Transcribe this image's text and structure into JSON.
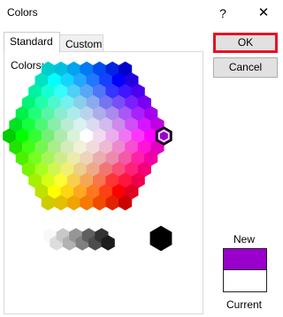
{
  "window": {
    "title": "Colors",
    "help_label": "?",
    "close_label": "✕"
  },
  "tabs": [
    {
      "label": "Standard"
    },
    {
      "label": "Custom"
    }
  ],
  "colors_label": "Colors:",
  "buttons": {
    "ok": "OK",
    "cancel": "Cancel"
  },
  "preview": {
    "new_label": "New",
    "current_label": "Current",
    "new_color": "#9900cc",
    "current_color": "#ffffff"
  },
  "selected_color": "#9900cc",
  "grays": [
    "#f8f8f8",
    "#dddddd",
    "#c8c8c8",
    "#b2b2b2",
    "#969696",
    "#808080",
    "#5f5f5f",
    "#4d4d4d",
    "#333333",
    "#1c1c1c"
  ],
  "large_swatches": [
    "#ffffff",
    "#000000"
  ]
}
